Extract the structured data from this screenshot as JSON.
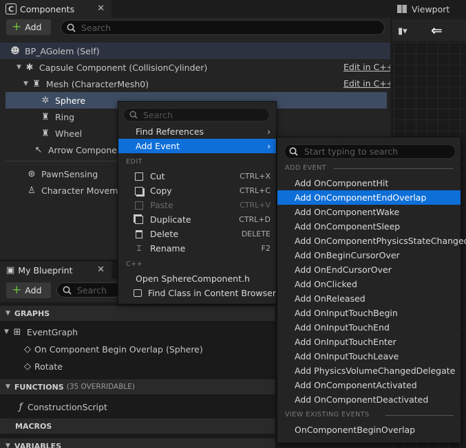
{
  "components_panel": {
    "tab_label": "Components",
    "add_label": "Add",
    "search_placeholder": "Search",
    "tree": [
      {
        "label": "BP_AGolem (Self)"
      },
      {
        "label": "Capsule Component (CollisionCylinder)",
        "link": "Edit in C++"
      },
      {
        "label": "Mesh (CharacterMesh0)",
        "link": "Edit in C++"
      },
      {
        "label": "Sphere"
      },
      {
        "label": "Ring"
      },
      {
        "label": "Wheel"
      },
      {
        "label": "Arrow Component"
      },
      {
        "label": "PawnSensing"
      },
      {
        "label": "Character Movement"
      }
    ]
  },
  "viewport": {
    "tab_label": "Viewport"
  },
  "my_blueprint": {
    "tab_label": "My Blueprint",
    "add_label": "Add",
    "search_placeholder": "Search",
    "graphs_label": "GRAPHS",
    "event_graph": "EventGraph",
    "events": [
      "On Component Begin Overlap (Sphere)",
      "Rotate"
    ],
    "functions_label": "FUNCTIONS",
    "functions_sub": "(35 OVERRIDABLE)",
    "construction_script": "ConstructionScript",
    "macros_label": "MACROS",
    "variables_label": "VARIABLES"
  },
  "context_menu": {
    "search_placeholder": "Search",
    "find_references": "Find References",
    "add_event": "Add Event",
    "edit_section": "EDIT",
    "items": [
      {
        "label": "Cut",
        "shortcut": "CTRL+X"
      },
      {
        "label": "Copy",
        "shortcut": "CTRL+C"
      },
      {
        "label": "Paste",
        "shortcut": "CTRL+V",
        "disabled": true
      },
      {
        "label": "Duplicate",
        "shortcut": "CTRL+D"
      },
      {
        "label": "Delete",
        "shortcut": "DELETE"
      },
      {
        "label": "Rename",
        "shortcut": "F2"
      }
    ],
    "cpp_section": "C++",
    "open_header": "Open SphereComponent.h",
    "find_class": "Find Class in Content Browser"
  },
  "event_submenu": {
    "search_placeholder": "Start typing to search",
    "add_event_section": "ADD EVENT",
    "events": [
      "Add OnComponentHit",
      "Add OnComponentEndOverlap",
      "Add OnComponentWake",
      "Add OnComponentSleep",
      "Add OnComponentPhysicsStateChanged",
      "Add OnBeginCursorOver",
      "Add OnEndCursorOver",
      "Add OnClicked",
      "Add OnReleased",
      "Add OnInputTouchBegin",
      "Add OnInputTouchEnd",
      "Add OnInputTouchEnter",
      "Add OnInputTouchLeave",
      "Add PhysicsVolumeChangedDelegate",
      "Add OnComponentActivated",
      "Add OnComponentDeactivated"
    ],
    "view_section": "VIEW EXISTING EVENTS",
    "existing": [
      "OnComponentBeginOverlap"
    ]
  },
  "colors": {
    "accent": "#0f6fd8",
    "selected_row": "#3e4c62",
    "add_plus": "#70c040"
  }
}
